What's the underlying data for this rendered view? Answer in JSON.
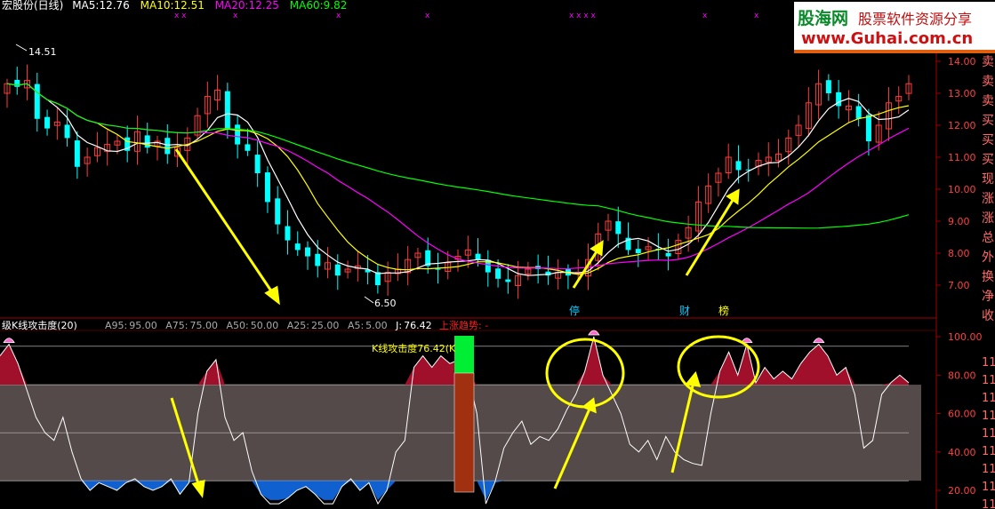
{
  "main_panel": {
    "title": "宏股份(日线)",
    "ma": [
      {
        "label": "MA5:",
        "value": "12.76",
        "color": "#ffffff"
      },
      {
        "label": "MA10:",
        "value": "12.51",
        "color": "#ffff00"
      },
      {
        "label": "MA20:",
        "value": "12.25",
        "color": "#ff00ff"
      },
      {
        "label": "MA60:",
        "value": "9.82",
        "color": "#00ff00"
      }
    ],
    "marker_row": [
      "x x",
      "x",
      "x",
      "x",
      "x x x x",
      "x",
      "x"
    ],
    "high_label": "14.51",
    "low_label": "6.50",
    "side_chars": [
      "卖",
      "卖",
      "卖",
      "买",
      "买",
      "买",
      "现",
      "涨",
      "涨",
      "总",
      "外",
      "换",
      "净",
      "收"
    ],
    "event_labels": [
      "停",
      "财",
      "榜"
    ]
  },
  "indicator_panel": {
    "title": "级K线攻击度(20)",
    "params": [
      {
        "label": "A95:",
        "value": "95.00"
      },
      {
        "label": "A75:",
        "value": "75.00"
      },
      {
        "label": "A50:",
        "value": "50.00"
      },
      {
        "label": "A25:",
        "value": "25.00"
      },
      {
        "label": "A5:",
        "value": "5.00"
      },
      {
        "label": "J:",
        "value": "76.42"
      }
    ],
    "trend_label": "上涨趋势: -",
    "readout": "K线攻击度76.42(K",
    "side_chars": [
      "11",
      "11",
      "11",
      "11",
      "11",
      "11",
      "11",
      "11",
      "11"
    ]
  },
  "logo": {
    "name": "股海网",
    "slogan": "股票软件资源分享",
    "url": "www.Guhai.com.cn"
  },
  "colors": {
    "up": "#ff3c3c",
    "down": "#00ffff",
    "hot": "#a0102a",
    "cold": "#1060d0",
    "band": "#554a4a",
    "annotation": "#ffff00",
    "axis": "#a00000"
  },
  "chart_data": [
    {
      "type": "candlestick",
      "title": "宏股份(日线)",
      "y_axis": {
        "ticks": [
          7.0,
          8.0,
          9.0,
          10.0,
          11.0,
          12.0,
          13.0,
          14.0
        ],
        "ylim": [
          6.4,
          14.8
        ]
      },
      "series": [
        {
          "name": "MA5",
          "value": 12.76
        },
        {
          "name": "MA10",
          "value": 12.51
        },
        {
          "name": "MA20",
          "value": 12.25
        },
        {
          "name": "MA60",
          "value": 9.82
        }
      ],
      "annotations": [
        {
          "text": "14.51",
          "kind": "period high"
        },
        {
          "text": "6.50",
          "kind": "period low"
        }
      ],
      "close_path": [
        13.3,
        13.2,
        13.4,
        12.2,
        11.9,
        12.1,
        11.6,
        10.7,
        11.0,
        11.3,
        11.4,
        11.5,
        11.2,
        11.8,
        11.3,
        11.5,
        11.1,
        11.3,
        11.6,
        12.3,
        12.9,
        13.1,
        11.9,
        11.4,
        11.2,
        10.5,
        9.6,
        8.9,
        8.4,
        8.1,
        7.9,
        7.6,
        7.7,
        7.3,
        7.5,
        7.6,
        7.4,
        7.0,
        7.4,
        7.5,
        7.8,
        8.0,
        7.6,
        7.5,
        7.7,
        7.9,
        8.1,
        7.8,
        7.4,
        7.2,
        7.1,
        7.3,
        7.5,
        7.5,
        7.3,
        7.4,
        7.3,
        7.4,
        7.8,
        8.6,
        9.0,
        8.6,
        8.1,
        8.0,
        8.2,
        8.1,
        7.9,
        8.4,
        8.8,
        9.6,
        10.1,
        10.5,
        11.0,
        10.6,
        10.6,
        10.9,
        11.0,
        11.1,
        11.6,
        12.0,
        12.7,
        13.3,
        13.0,
        12.6,
        12.6,
        12.2,
        11.5,
        12.0,
        12.7,
        12.9,
        13.3
      ]
    },
    {
      "type": "area",
      "title": "级K线攻击度(20)",
      "y_axis": {
        "ticks": [
          20.0,
          40.0,
          60.0,
          80.0,
          100.0
        ],
        "ylim": [
          15,
          104
        ]
      },
      "reference_lines": [
        95,
        75,
        50,
        25,
        5
      ],
      "series": [
        {
          "name": "J",
          "last_value": 76.42,
          "values": [
            90,
            96,
            86,
            72,
            58,
            50,
            46,
            58,
            40,
            26,
            20,
            24,
            22,
            20,
            24,
            26,
            22,
            20,
            22,
            26,
            18,
            24,
            60,
            82,
            88,
            58,
            46,
            50,
            30,
            18,
            10,
            12,
            16,
            20,
            22,
            18,
            10,
            8,
            22,
            26,
            20,
            24,
            8,
            20,
            40,
            46,
            84,
            90,
            84,
            90,
            86,
            88,
            80,
            60,
            12,
            24,
            42,
            50,
            56,
            44,
            48,
            46,
            52,
            62,
            70,
            82,
            100,
            80,
            70,
            60,
            44,
            40,
            46,
            36,
            48,
            40,
            36,
            34,
            33,
            60,
            82,
            92,
            80,
            96,
            76,
            84,
            78,
            82,
            78,
            86,
            92,
            96,
            90,
            80,
            84,
            70,
            42,
            46,
            70,
            76,
            80,
            76
          ]
        }
      ]
    }
  ]
}
